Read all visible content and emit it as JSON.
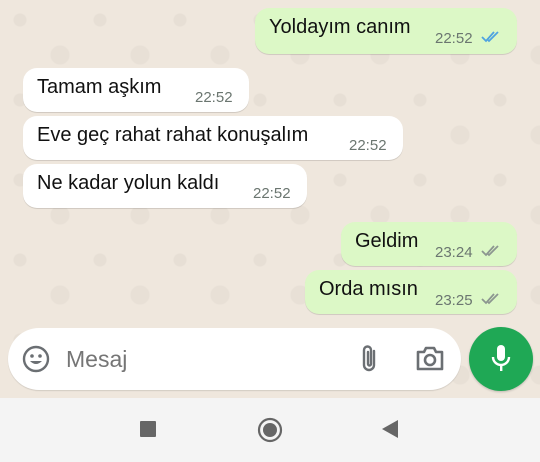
{
  "messages": [
    {
      "direction": "out",
      "text": "Yoldayım canım",
      "time": "22:52",
      "status": "read"
    },
    {
      "direction": "in",
      "text": "Tamam aşkım",
      "time": "22:52"
    },
    {
      "direction": "in",
      "text": "Eve geç rahat rahat konuşalım",
      "time": "22:52"
    },
    {
      "direction": "in",
      "text": "Ne kadar yolun kaldı",
      "time": "22:52"
    },
    {
      "direction": "out",
      "text": "Geldim",
      "time": "23:24",
      "status": "delivered"
    },
    {
      "direction": "out",
      "text": "Orda mısın",
      "time": "23:25",
      "status": "delivered"
    }
  ],
  "composer": {
    "placeholder": "Mesaj",
    "icons": [
      "emoji-icon",
      "attach-icon",
      "camera-icon",
      "mic-icon"
    ]
  },
  "colors": {
    "outgoing_bubble": "#dcf8c6",
    "incoming_bubble": "#ffffff",
    "read_ticks": "#4fa3e0",
    "delivered_ticks": "#8c9690",
    "send_button": "#1fa855"
  },
  "navbar": {
    "icons": [
      "recents-square-icon",
      "home-circle-icon",
      "back-triangle-icon"
    ]
  }
}
